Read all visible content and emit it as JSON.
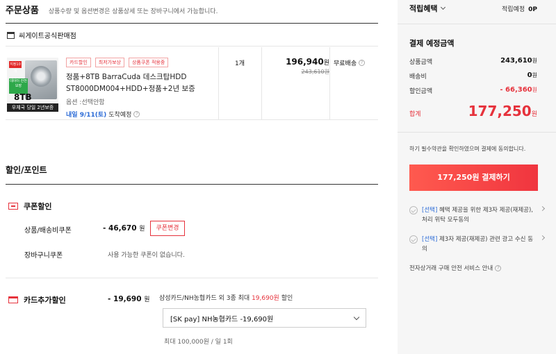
{
  "order": {
    "title": "주문상품",
    "note": "상품수량 및 옵션변경은 상품상세 또는 장바구니에서 가능합니다."
  },
  "store": {
    "name": "씨게이트공식판매점"
  },
  "product": {
    "image": {
      "red_tag": "지정10개",
      "green_tag": "데이터 안전보장",
      "size": "8TB",
      "strip": "우체국 당일 2년보증"
    },
    "badges": [
      "카드할인",
      "최저가보상",
      "상품쿠폰 적용중"
    ],
    "name": "정품+8TB BarraCuda 데스크탑HDD ST8000DM004+HDD+정품+2년 보증",
    "option": "옵션 :선택안함",
    "delivery_date": "내일 9/11(토)",
    "delivery_suffix": "도착예정",
    "qty": "1개",
    "price": "196,940",
    "price_unit": "원",
    "original_price": "243,610원",
    "shipping": "무료배송",
    "help": "?"
  },
  "discount": {
    "title": "할인/포인트",
    "coupon": {
      "title": "쿠폰할인",
      "item_label": "상품/배송비쿠폰",
      "item_value": "- 46,670",
      "unit": "원",
      "change_button": "쿠폰변경",
      "cart_label": "장바구니쿠폰",
      "cart_msg": "사용 가능한 쿠폰이 없습니다."
    },
    "card": {
      "title": "카드추가할인",
      "value": "- 19,690",
      "unit": "원",
      "desc_prefix": "삼성카드/NH농협카드 외 3종 최대 ",
      "desc_amount": "19,690원",
      "desc_suffix": " 할인",
      "selected": "[SK pay] NH농협카드 -19,690원",
      "limit": "최대 100,000원 / 일 1회"
    }
  },
  "summary": {
    "points_title": "적립혜택",
    "points_label": "적립예정",
    "points_value": "0P",
    "title": "결제 예정금액",
    "rows": [
      {
        "label": "상품금액",
        "value": "243,610",
        "unit": "원"
      },
      {
        "label": "배송비",
        "value": "0",
        "unit": "원"
      },
      {
        "label": "할인금액",
        "value": "- 66,360",
        "unit": "원"
      }
    ],
    "total_label": "합계",
    "total_value": "177,250",
    "total_unit": "원",
    "agree_text": "하기 필수약관을 확인하였으며 결제에 동의합니다.",
    "pay_button": "177,250원 결제하기",
    "options": [
      {
        "tag": "[선택]",
        "text": " 혜택 제공을 위한 제3자 제공(재제공), 처리 위탁 모두동의"
      },
      {
        "tag": "[선택]",
        "text": " 제3자 제공(재제공) 관련 광고 수신 동의"
      }
    ],
    "safe_service": "전자상거래 구매 안전 서비스 안내"
  },
  "colors": {
    "accent": "#e6323c",
    "link": "#2a6ad6",
    "sidebar_bg": "#f6f6f6"
  }
}
